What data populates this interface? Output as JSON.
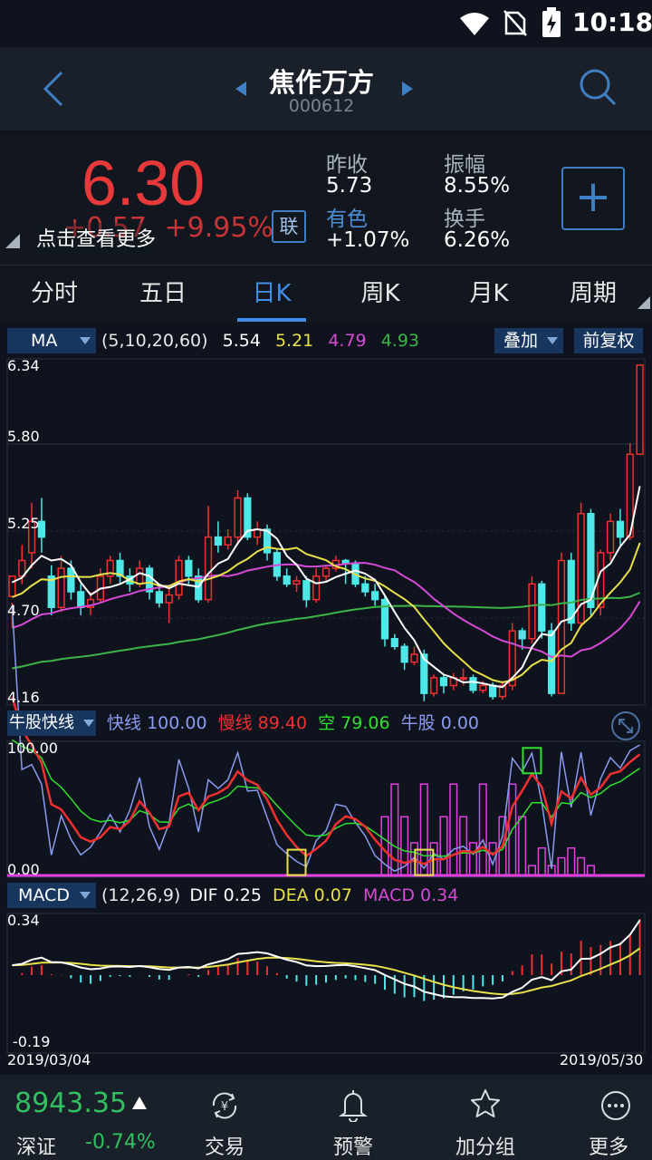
{
  "status_bar": {
    "time": "10:18"
  },
  "header": {
    "stock_name": "焦作万方",
    "stock_code": "000612",
    "back_icon": "chevron-left-icon",
    "search_icon": "search-icon"
  },
  "quote": {
    "price": "6.30",
    "change": "+0.57",
    "change_pct": "+9.95%",
    "hint": "点击查看更多",
    "link_badge": "联",
    "prev_close_label": "昨收",
    "prev_close": "5.73",
    "sector_label": "有色",
    "sector_change": "+1.07%",
    "amplitude_label": "振幅",
    "amplitude": "8.55%",
    "turnover_label": "换手",
    "turnover": "6.26%",
    "add_button": "+"
  },
  "tabs": [
    "分时",
    "五日",
    "日K",
    "周K",
    "月K",
    "周期"
  ],
  "active_tab": 2,
  "indicators": {
    "ma": {
      "selector": "MA",
      "params": "(5,10,20,60)",
      "v5": "5.54",
      "v10": "5.21",
      "v20": "4.79",
      "v60": "4.93",
      "overlay": "叠加",
      "restore": "前复权"
    },
    "price_axis": [
      "6.34",
      "5.80",
      "5.25",
      "4.70",
      "4.16"
    ],
    "niugu": {
      "selector": "牛股快线",
      "fast_label": "快线",
      "fast": "100.00",
      "slow_label": "慢线",
      "slow": "89.40",
      "short_label": "空",
      "short": "79.06",
      "bull_label": "牛股",
      "bull": "0.00",
      "axis_top": "100.00",
      "axis_bottom": "0.00"
    },
    "macd": {
      "selector": "MACD",
      "params": "(12,26,9)",
      "dif_label": "DIF",
      "dif": "0.25",
      "dea_label": "DEA",
      "dea": "0.07",
      "macd_label": "MACD",
      "macd": "0.34",
      "axis_top": "0.34",
      "axis_bottom": "-0.19"
    },
    "date_start": "2019/03/04",
    "date_end": "2019/05/30"
  },
  "bottom_nav": {
    "index_value": "8943.35",
    "index_name": "深证",
    "index_change": "-0.74%",
    "items": [
      {
        "label": "交易",
        "icon": "trade-icon"
      },
      {
        "label": "预警",
        "icon": "bell-icon"
      },
      {
        "label": "加分组",
        "icon": "star-icon"
      },
      {
        "label": "更多",
        "icon": "more-icon"
      }
    ]
  },
  "chart_data": {
    "type": "candlestick",
    "title": "",
    "x_range": [
      "2019/03/04",
      "2019/05/30"
    ],
    "y_range": [
      4.16,
      6.34
    ],
    "ohlc": [
      [
        4.82,
        4.95,
        4.78,
        4.62
      ],
      [
        4.95,
        5.05,
        5.15,
        4.9
      ],
      [
        5.1,
        5.3,
        5.42,
        5.0
      ],
      [
        5.3,
        5.2,
        5.45,
        5.1
      ],
      [
        4.95,
        4.75,
        5.02,
        4.7
      ],
      [
        4.75,
        5.0,
        5.08,
        4.72
      ],
      [
        5.0,
        4.85,
        5.05,
        4.8
      ],
      [
        4.85,
        4.75,
        4.9,
        4.7
      ],
      [
        4.75,
        4.8,
        4.85,
        4.7
      ],
      [
        4.8,
        4.95,
        5.0,
        4.78
      ],
      [
        4.95,
        5.05,
        5.08,
        4.9
      ],
      [
        5.05,
        4.95,
        5.1,
        4.9
      ],
      [
        4.95,
        4.9,
        5.0,
        4.85
      ],
      [
        4.9,
        5.0,
        5.05,
        4.88
      ],
      [
        5.0,
        4.85,
        5.02,
        4.8
      ],
      [
        4.85,
        4.78,
        4.9,
        4.75
      ],
      [
        4.78,
        4.83,
        4.88,
        4.65
      ],
      [
        4.83,
        5.05,
        5.08,
        4.8
      ],
      [
        5.05,
        4.95,
        5.08,
        4.9
      ],
      [
        4.95,
        4.8,
        5.0,
        4.78
      ],
      [
        4.8,
        5.2,
        5.4,
        4.78
      ],
      [
        5.2,
        5.15,
        5.3,
        5.1
      ],
      [
        5.15,
        5.2,
        5.25,
        5.12
      ],
      [
        5.2,
        5.45,
        5.5,
        5.15
      ],
      [
        5.45,
        5.2,
        5.48,
        5.18
      ],
      [
        5.2,
        5.25,
        5.3,
        5.15
      ],
      [
        5.25,
        5.1,
        5.28,
        5.05
      ],
      [
        5.1,
        4.95,
        5.12,
        4.92
      ],
      [
        4.95,
        4.9,
        5.0,
        4.88
      ],
      [
        4.9,
        4.92,
        4.95,
        4.85
      ],
      [
        4.92,
        4.8,
        4.95,
        4.75
      ],
      [
        4.8,
        4.95,
        5.0,
        4.78
      ],
      [
        4.95,
        5.0,
        5.02,
        4.92
      ],
      [
        5.0,
        5.05,
        5.08,
        4.98
      ],
      [
        5.05,
        5.03,
        5.06,
        4.9
      ],
      [
        5.03,
        4.9,
        5.05,
        4.88
      ],
      [
        4.9,
        4.85,
        4.95,
        4.82
      ],
      [
        4.85,
        4.8,
        4.9,
        4.76
      ],
      [
        4.8,
        4.55,
        4.82,
        4.5
      ],
      [
        4.55,
        4.5,
        4.58,
        4.48
      ],
      [
        4.5,
        4.4,
        4.52,
        4.35
      ],
      [
        4.4,
        4.45,
        4.5,
        4.38
      ],
      [
        4.45,
        4.2,
        4.48,
        4.15
      ],
      [
        4.2,
        4.3,
        4.32,
        4.18
      ],
      [
        4.3,
        4.25,
        4.32,
        4.2
      ],
      [
        4.25,
        4.3,
        4.33,
        4.22
      ],
      [
        4.3,
        4.3,
        4.36,
        4.25
      ],
      [
        4.3,
        4.22,
        4.32,
        4.2
      ],
      [
        4.22,
        4.25,
        4.28,
        4.2
      ],
      [
        4.25,
        4.18,
        4.27,
        4.16
      ],
      [
        4.18,
        4.25,
        4.28,
        4.16
      ],
      [
        4.25,
        4.6,
        4.65,
        4.22
      ],
      [
        4.6,
        4.55,
        4.62,
        4.48
      ],
      [
        4.55,
        4.9,
        4.95,
        4.52
      ],
      [
        4.9,
        4.6,
        4.92,
        4.55
      ],
      [
        4.6,
        4.2,
        4.65,
        4.18
      ],
      [
        4.2,
        5.05,
        5.1,
        4.55
      ],
      [
        5.05,
        4.65,
        5.1,
        4.6
      ],
      [
        4.65,
        5.35,
        5.42,
        4.62
      ],
      [
        5.35,
        4.75,
        5.38,
        4.7
      ],
      [
        4.75,
        5.1,
        5.12,
        4.7
      ],
      [
        5.1,
        5.3,
        5.35,
        5.05
      ],
      [
        5.3,
        5.2,
        5.38,
        5.15
      ],
      [
        5.2,
        5.73,
        5.8,
        5.18
      ],
      [
        5.73,
        6.3,
        6.3,
        5.75
      ]
    ]
  }
}
